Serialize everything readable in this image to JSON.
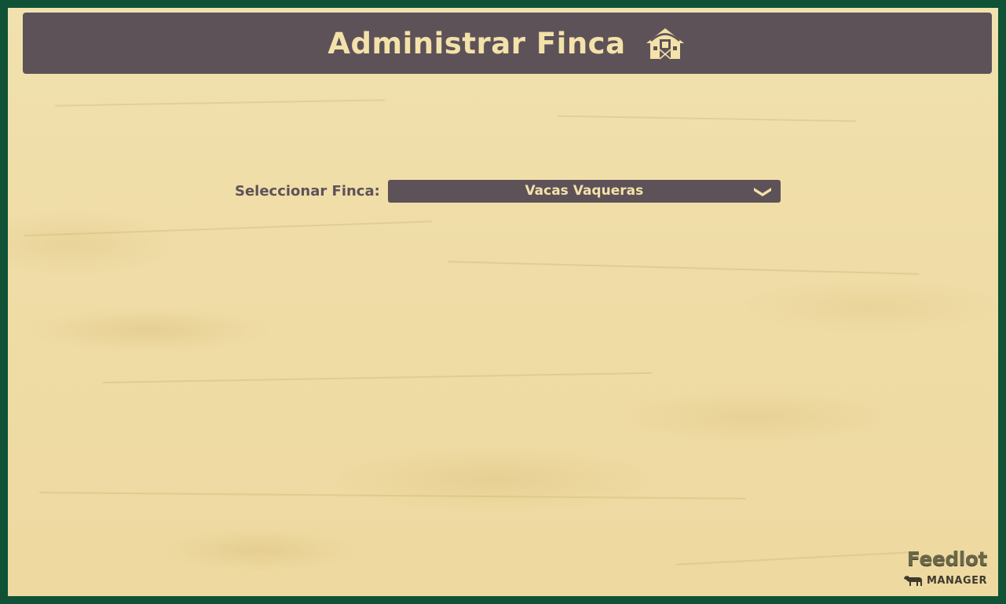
{
  "header": {
    "title": "Administrar Finca",
    "icon": "barn-icon"
  },
  "farm_selector": {
    "label": "Seleccionar Finca:",
    "selected_value": "Vacas Vaqueras",
    "icon": "chevron-down-icon"
  },
  "logo": {
    "line1": "Feedlot",
    "line2": "MANAGER",
    "icon": "cow-icon"
  },
  "colors": {
    "frame": "#0f5236",
    "background": "#efdca7",
    "header_bg": "#5e5259",
    "header_text": "#f3e2a9",
    "label_text": "#5e5259"
  }
}
